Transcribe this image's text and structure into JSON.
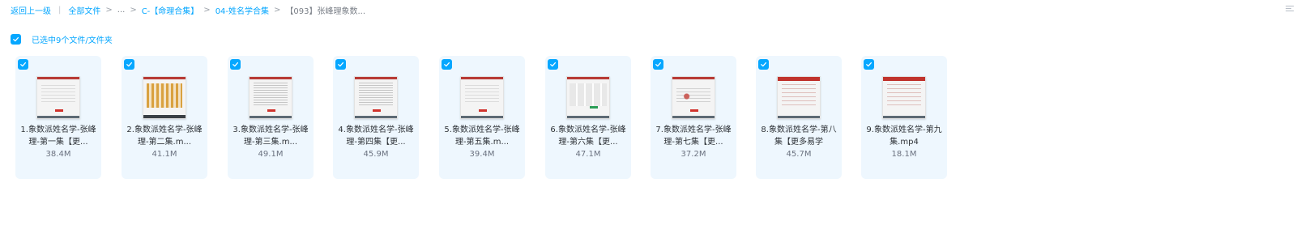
{
  "breadcrumb": {
    "back": "返回上一级",
    "all_files": "全部文件",
    "ellipsis": "...",
    "folder1": "C-【命理合集】",
    "folder2": "04-姓名学合集",
    "current": "【093】张峰理象数..."
  },
  "selection": {
    "label": "已选中9个文件/文件夹"
  },
  "files": [
    {
      "name": "1.象数派姓名学-张峰理-第一集【更...",
      "size": "38.4M"
    },
    {
      "name": "2.象数派姓名学-张峰理-第二集.m...",
      "size": "41.1M"
    },
    {
      "name": "3.象数派姓名学-张峰理-第三集.m...",
      "size": "49.1M"
    },
    {
      "name": "4.象数派姓名学-张峰理-第四集【更...",
      "size": "45.9M"
    },
    {
      "name": "5.象数派姓名学-张峰理-第五集.m...",
      "size": "39.4M"
    },
    {
      "name": "6.象数派姓名学-张峰理-第六集【更...",
      "size": "47.1M"
    },
    {
      "name": "7.象数派姓名学-张峰理-第七集【更...",
      "size": "37.2M"
    },
    {
      "name": "8.象数派姓名学-第八集【更多易学",
      "size": "45.7M"
    },
    {
      "name": "9.象数派姓名学-第九集.mp4",
      "size": "18.1M"
    }
  ],
  "icons": {
    "checkbox": "check-icon",
    "view_toggle": "list-view-icon"
  },
  "colors": {
    "accent": "#06a7ff",
    "card_bg": "#eef7fe"
  }
}
